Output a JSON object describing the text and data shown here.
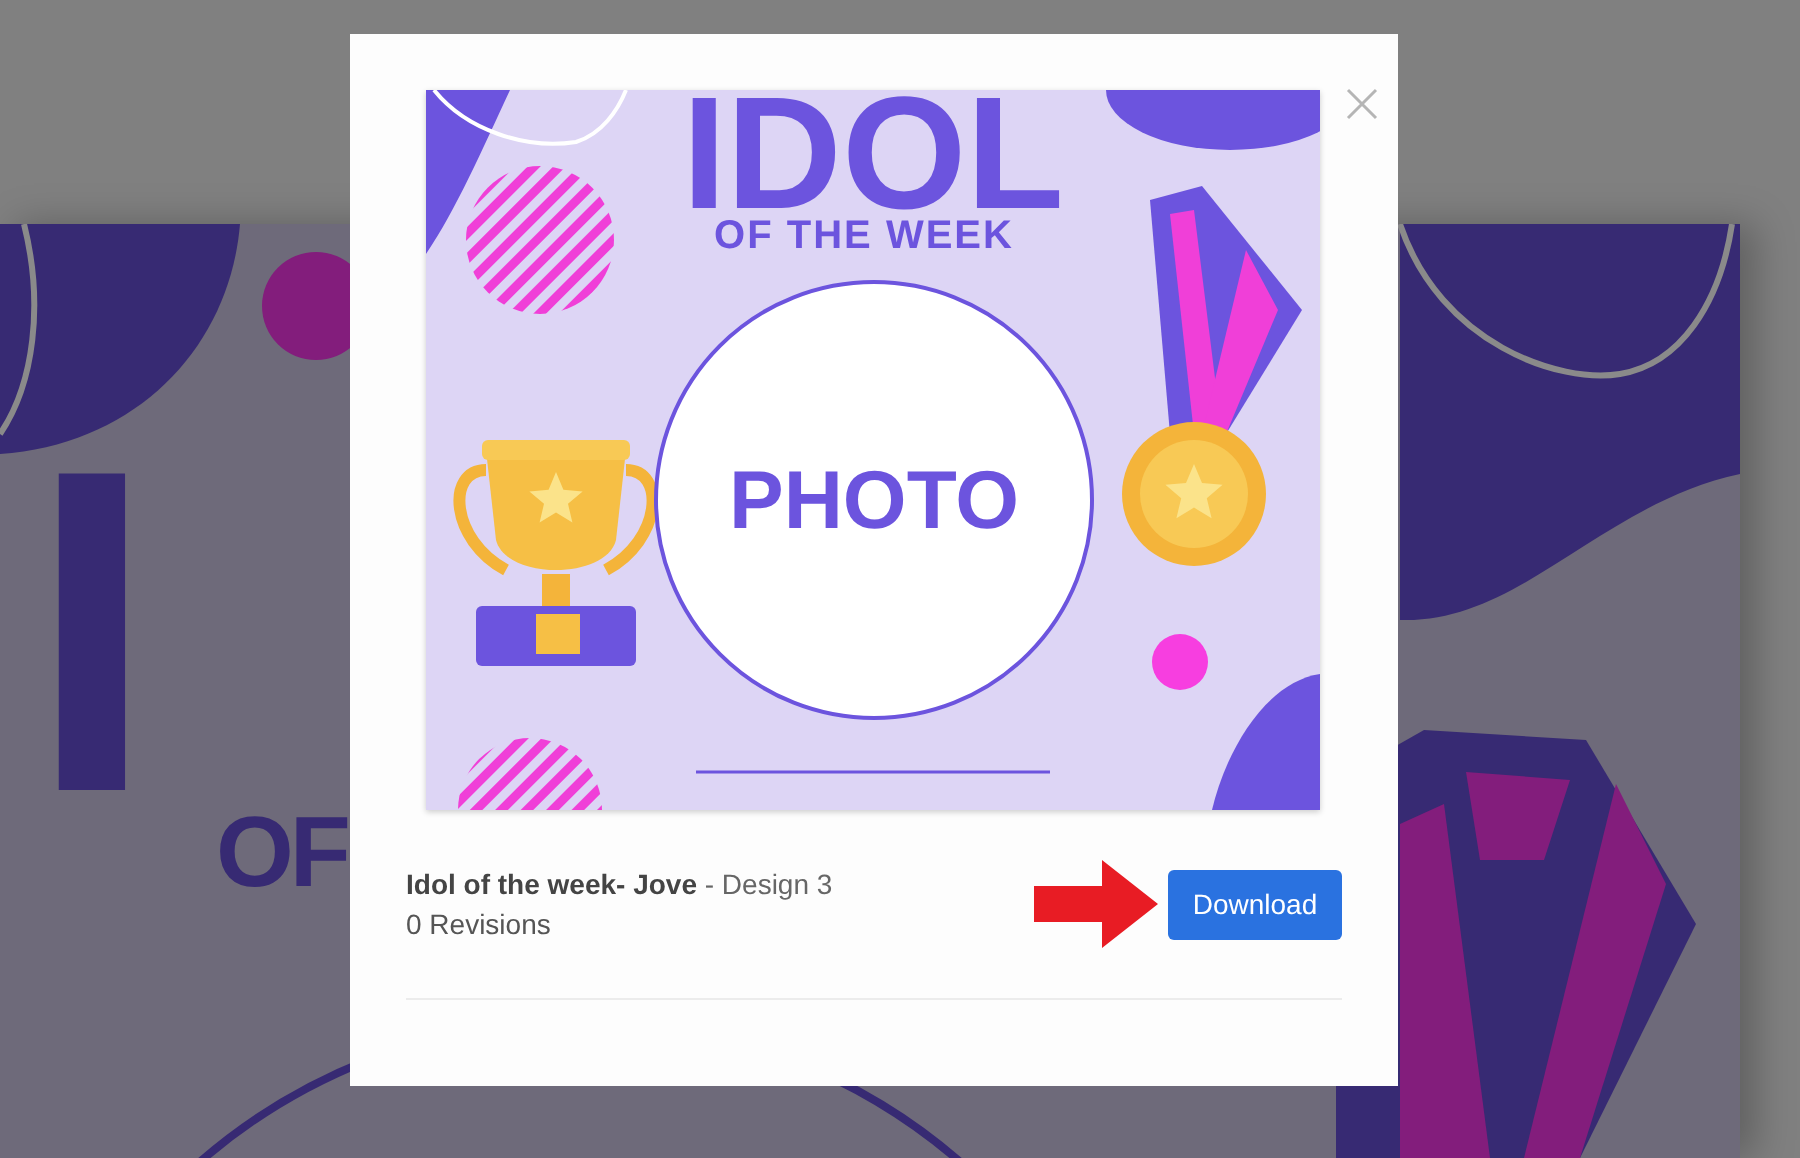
{
  "backdrop": {
    "title": "I",
    "subtitle": "OF"
  },
  "design": {
    "title": "IDOL",
    "subtitle": "OF THE WEEK",
    "photo_label": "PHOTO"
  },
  "caption": "**Idol of the week- Jove** - Design 3",
  "revisions": "0 Revisions",
  "download_button": "Download"
}
